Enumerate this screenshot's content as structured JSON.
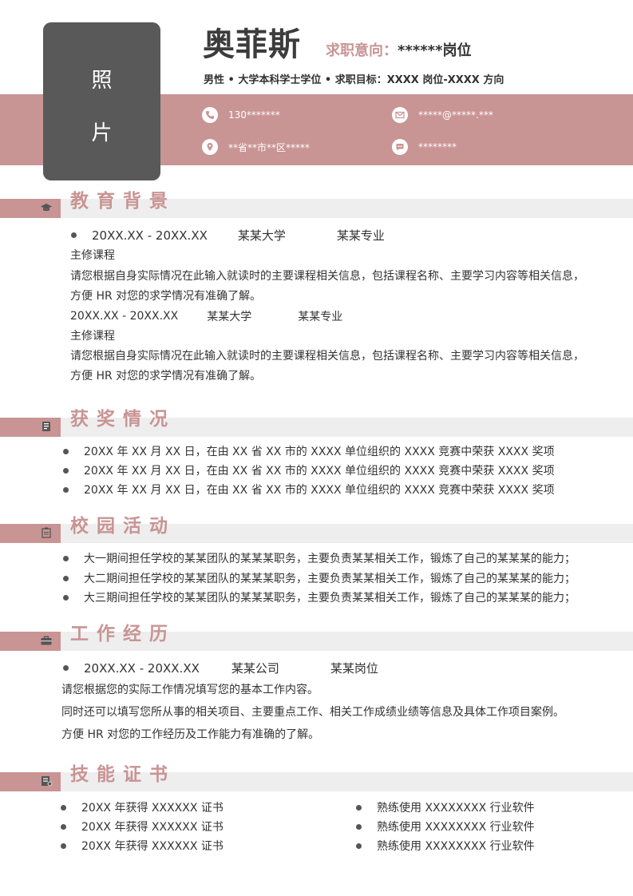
{
  "header": {
    "photo_char_1": "照",
    "photo_char_2": "片",
    "name": "奥菲斯",
    "intent_label": "求职意向：",
    "intent_value": "******岗位",
    "meta": "男性 • 大学本科学士学位 • 求职目标：XXXX 岗位-XXXX 方向"
  },
  "contacts": {
    "phone": "130*******",
    "email": "*****@*****.***",
    "address": "**省**市**区*****",
    "wechat": "********",
    "icons": [
      "phone-icon",
      "mail-icon",
      "location-icon",
      "chat-icon"
    ]
  },
  "education": {
    "title": "教育背景",
    "icon": "graduation-cap-icon",
    "entries": [
      {
        "period": "20XX.XX - 20XX.XX",
        "school": "某某大学",
        "major": "某某专业",
        "course_label": "主修课程",
        "desc_1": "请您根据自身实际情况在此输入就读时的主要课程相关信息，包括课程名称、主要学习内容等相关信息，",
        "desc_2": "方便 HR 对您的求学情况有准确了解。"
      },
      {
        "period": "20XX.XX - 20XX.XX",
        "school": "某某大学",
        "major": "某某专业",
        "course_label": "主修课程",
        "desc_1": "请您根据自身实际情况在此输入就读时的主要课程相关信息，包括课程名称、主要学习内容等相关信息，",
        "desc_2": "方便 HR 对您的求学情况有准确了解。"
      }
    ]
  },
  "awards": {
    "title": "获奖情况",
    "icon": "award-icon",
    "items": [
      "20XX 年 XX 月 XX 日，在由 XX 省 XX 市的 XXXX 单位组织的 XXXX 竞赛中荣获 XXXX 奖项",
      "20XX 年 XX 月 XX 日，在由 XX 省 XX 市的 XXXX 单位组织的 XXXX 竞赛中荣获 XXXX 奖项",
      "20XX 年 XX 月 XX 日，在由 XX 省 XX 市的 XXXX 单位组织的 XXXX 竞赛中荣获 XXXX 奖项"
    ]
  },
  "campus": {
    "title": "校园活动",
    "icon": "clipboard-icon",
    "items": [
      "大一期间担任学校的某某团队的某某某职务，主要负责某某相关工作，锻炼了自己的某某某的能力；",
      "大二期间担任学校的某某团队的某某某职务，主要负责某某相关工作，锻炼了自己的某某某的能力；",
      "大三期间担任学校的某某团队的某某某职务，主要负责某某相关工作，锻炼了自己的某某某的能力；"
    ]
  },
  "work": {
    "title": "工作经历",
    "icon": "briefcase-icon",
    "period": "20XX.XX - 20XX.XX",
    "company": "某某公司",
    "position": "某某岗位",
    "lines": [
      "请您根据您的实际工作情况填写您的基本工作内容。",
      "同时还可以填写您所从事的相关项目、主要重点工作、相关工作成绩业绩等信息及具体工作项目案例。",
      "方便 HR 对您的工作经历及工作能力有准确的了解。"
    ]
  },
  "skills": {
    "title": "技能证书",
    "icon": "certificate-icon",
    "left": [
      "20XX 年获得 XXXXXX 证书",
      "20XX 年获得 XXXXXX 证书",
      "20XX 年获得 XXXXXX 证书"
    ],
    "right": [
      "熟练使用 XXXXXXXX 行业软件",
      "熟练使用 XXXXXXXX 行业软件",
      "熟练使用 XXXXXXXX 行业软件"
    ]
  },
  "colors": {
    "accent": "#c99494",
    "photo": "#595959",
    "bar": "#eeeeee",
    "text": "#333333"
  }
}
